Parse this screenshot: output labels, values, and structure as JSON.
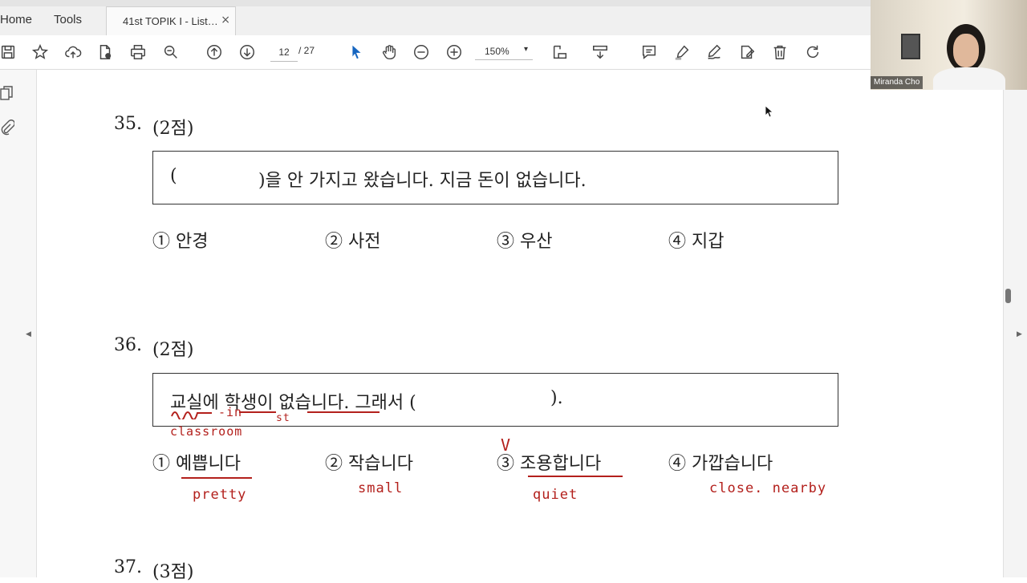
{
  "tabs": {
    "home": "Home",
    "tools": "Tools",
    "document": "41st TOPIK I - List…",
    "close": "×"
  },
  "toolbar": {
    "page_current": "12",
    "page_total": "/ 27",
    "zoom": "150%"
  },
  "icons": [
    "save-icon",
    "star-icon",
    "cloud-upload-icon",
    "file-icon",
    "print-icon",
    "zoom-search-icon",
    "arrow-up-icon",
    "arrow-down-icon",
    "select-cursor-icon",
    "hand-icon",
    "zoom-out-icon",
    "zoom-in-icon",
    "page-fit-icon",
    "scroll-mode-icon",
    "comment-icon",
    "highlight-icon",
    "sign-icon",
    "edit-icon",
    "delete-icon",
    "rotate-icon"
  ],
  "document": {
    "q35": {
      "number": "35.",
      "points": "(2점)",
      "prompt_open": "(",
      "prompt_rest": ")을 안 가지고 왔습니다. 지금 돈이 없습니다.",
      "options": [
        "① 안경",
        "② 사전",
        "③ 우산",
        "④ 지갑"
      ]
    },
    "q36": {
      "number": "36.",
      "points": "(2점)",
      "prompt": "교실에 학생이 없습니다. 그래서 (",
      "prompt_close": ").",
      "options": [
        "① 예쁩니다",
        "② 작습니다",
        "③ 조용합니다",
        "④ 가깝습니다"
      ]
    },
    "q37": {
      "number": "37.",
      "points": "(3점)"
    }
  },
  "annotations": {
    "in": "-in",
    "st": "st",
    "classroom": "classroom",
    "pretty": "pretty",
    "small": "small",
    "quiet": "quiet",
    "close": "close. nearby",
    "check": "V"
  },
  "webcam": {
    "name": "Miranda Cho"
  },
  "colors": {
    "annotation": "#b3201c",
    "select_accent": "#1565c0"
  }
}
